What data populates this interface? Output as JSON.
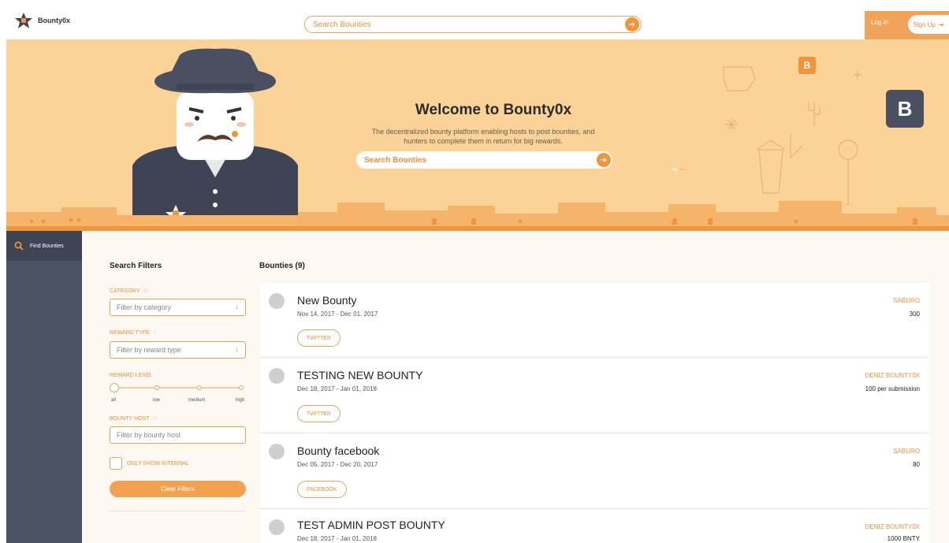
{
  "header": {
    "logo_text": "Bounty0x",
    "search_placeholder": "Search Bounties",
    "login_label": "Log In",
    "signup_label": "Sign Up"
  },
  "hero": {
    "title": "Welcome to Bounty0x",
    "subtitle": "The decentralized bounty platform enabling hosts to post bounties, and hunters to complete them in return for big rewards.",
    "search_placeholder": "Search Bounties",
    "badge_letter": "B"
  },
  "sidebar": {
    "items": [
      {
        "label": "Find Bounties",
        "icon": "search-icon"
      }
    ]
  },
  "filters": {
    "title": "Search Filters",
    "category_label": "CATEGORY",
    "category_placeholder": "Filter by category",
    "reward_type_label": "REWARD TYPE",
    "reward_type_placeholder": "Filter by reward type",
    "reward_level_label": "REWARD LEVEL",
    "reward_levels": [
      "all",
      "low",
      "medium",
      "high"
    ],
    "reward_level_selected": 0,
    "host_label": "BOUNTY HOST",
    "host_placeholder": "Filter by bounty host",
    "internal_label": "ONLY SHOW INTERNAL",
    "clear_label": "Clear Filters"
  },
  "bounties": {
    "title": "Bounties (9)",
    "items": [
      {
        "title": "New Bounty",
        "dates": "Nov 14, 2017 - Dec 01, 2017",
        "tag": "TWITTER",
        "host": "SABURO",
        "reward": "300"
      },
      {
        "title": "TESTING NEW BOUNTY",
        "dates": "Dec 18, 2017 - Jan 01, 2018",
        "tag": "TWITTER",
        "host": "DENIZ BOUNTY0X",
        "reward": "100 per submission"
      },
      {
        "title": "Bounty facebook",
        "dates": "Dec 05, 2017 - Dec 20, 2017",
        "tag": "FACEBOOK",
        "host": "SABURO",
        "reward": "80"
      },
      {
        "title": "TEST ADMIN POST BOUNTY",
        "dates": "Dec 18, 2017 - Jan 01, 2018",
        "tag": "",
        "host": "DENIZ BOUNTY0X",
        "reward": "1000 BNTY"
      }
    ]
  },
  "colors": {
    "accent": "#f0953a",
    "hero_bg": "#fbd399",
    "sidebar_bg": "#4b5263",
    "content_bg": "#fdf8f2"
  }
}
